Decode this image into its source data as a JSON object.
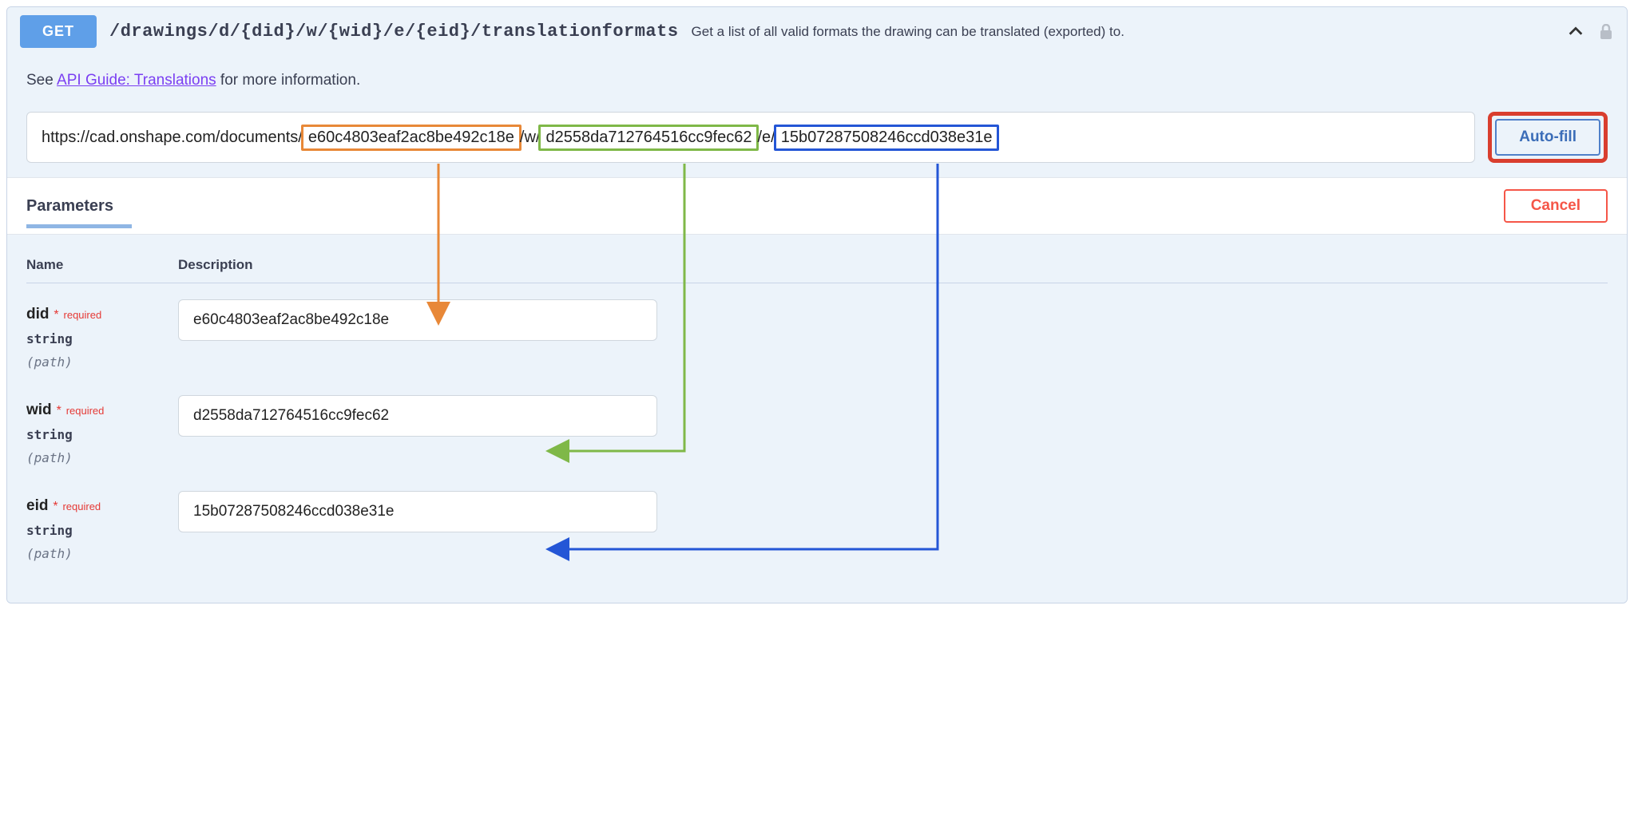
{
  "header": {
    "method": "GET",
    "path": "/drawings/d/{did}/w/{wid}/e/{eid}/translationformats",
    "description": "Get a list of all valid formats the drawing can be translated (exported) to."
  },
  "info": {
    "prefix": "See ",
    "link_text": "API Guide: Translations",
    "suffix": " for more information."
  },
  "url": {
    "base": "https://cad.onshape.com/documents/",
    "did": "e60c4803eaf2ac8be492c18e",
    "sep1": "/w/",
    "wid": "d2558da712764516cc9fec62",
    "sep2": "/e/",
    "eid": "15b07287508246ccd038e31e"
  },
  "buttons": {
    "autofill": "Auto-fill",
    "cancel": "Cancel"
  },
  "params": {
    "section_title": "Parameters",
    "col_name": "Name",
    "col_desc": "Description",
    "required_label": "required",
    "type_label": "string",
    "location_label": "(path)",
    "items": [
      {
        "name": "did",
        "value": "e60c4803eaf2ac8be492c18e"
      },
      {
        "name": "wid",
        "value": "d2558da712764516cc9fec62"
      },
      {
        "name": "eid",
        "value": "15b07287508246ccd038e31e"
      }
    ]
  },
  "colors": {
    "orange": "#e88838",
    "green": "#7fb848",
    "blue": "#2456d6",
    "red": "#d93e2e"
  }
}
